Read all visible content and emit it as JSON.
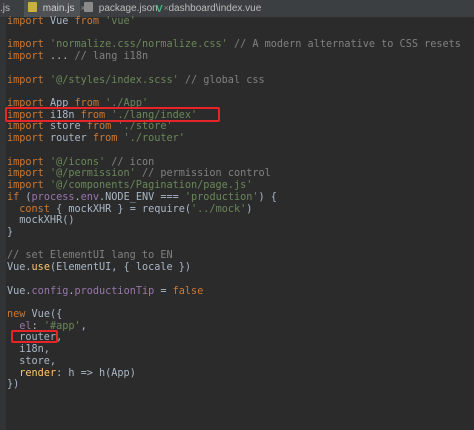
{
  "tabs": [
    {
      "label": ".js",
      "active": false,
      "icon": "js-file-icon"
    },
    {
      "label": "main.js",
      "active": true,
      "icon": "js-file-icon"
    },
    {
      "label": "package.json",
      "active": false,
      "icon": "json-file-icon"
    },
    {
      "label": "dashboard\\index.vue",
      "active": false,
      "icon": "vue-file-icon"
    }
  ],
  "close_glyph": "×",
  "lines": [
    [
      [
        "kw",
        "import "
      ],
      [
        "t",
        "Vue "
      ],
      [
        "kw",
        "from "
      ],
      [
        "str",
        "'vue'"
      ]
    ],
    [],
    [
      [
        "kw",
        "import "
      ],
      [
        "str",
        "'normalize.css/normalize.css' "
      ],
      [
        "cm",
        "// A modern alternative to CSS resets"
      ]
    ],
    [
      [
        "kw",
        "import "
      ],
      [
        "t",
        "... "
      ],
      [
        "cm",
        "// lang i18n"
      ]
    ],
    [],
    [
      [
        "kw",
        "import "
      ],
      [
        "str",
        "'@/styles/index.scss' "
      ],
      [
        "cm",
        "// global css"
      ]
    ],
    [],
    [
      [
        "kw",
        "import "
      ],
      [
        "t",
        "App "
      ],
      [
        "kw",
        "from "
      ],
      [
        "str",
        "'./App'"
      ]
    ],
    [
      [
        "kw",
        "import "
      ],
      [
        "t",
        "i18n "
      ],
      [
        "kw",
        "from "
      ],
      [
        "str",
        "'./lang/index'"
      ]
    ],
    [
      [
        "kw",
        "import "
      ],
      [
        "t",
        "store "
      ],
      [
        "kw",
        "from "
      ],
      [
        "str",
        "'./store'"
      ]
    ],
    [
      [
        "kw",
        "import "
      ],
      [
        "t",
        "router "
      ],
      [
        "kw",
        "from "
      ],
      [
        "str",
        "'./router'"
      ]
    ],
    [],
    [
      [
        "kw",
        "import "
      ],
      [
        "str",
        "'@/icons' "
      ],
      [
        "cm",
        "// icon"
      ]
    ],
    [
      [
        "kw",
        "import "
      ],
      [
        "str",
        "'@/permission' "
      ],
      [
        "cm",
        "// permission control"
      ]
    ],
    [
      [
        "kw",
        "import "
      ],
      [
        "str",
        "'@/components/Pagination/page.js'"
      ]
    ],
    [
      [
        "kw",
        "if "
      ],
      [
        "t",
        "("
      ],
      [
        "pr",
        "process"
      ],
      [
        "t",
        "."
      ],
      [
        "pr",
        "env"
      ],
      [
        "t",
        ".NODE_ENV === "
      ],
      [
        "str",
        "'production'"
      ],
      [
        "t",
        ") {"
      ]
    ],
    [
      [
        "t",
        "  "
      ],
      [
        "kw",
        "const "
      ],
      [
        "t",
        "{ mockXHR } = require("
      ],
      [
        "str",
        "'../mock'"
      ],
      [
        "t",
        ")"
      ]
    ],
    [
      [
        "t",
        "  mockXHR()"
      ]
    ],
    [
      [
        "t",
        "}"
      ]
    ],
    [],
    [
      [
        "cm",
        "// set ElementUI lang to EN"
      ]
    ],
    [
      [
        "t",
        "Vue."
      ],
      [
        "fn",
        "use"
      ],
      [
        "t",
        "(ElementUI, { locale })"
      ]
    ],
    [],
    [
      [
        "t",
        "Vue."
      ],
      [
        "pr",
        "config"
      ],
      [
        "t",
        "."
      ],
      [
        "pr",
        "productionTip "
      ],
      [
        "t",
        "= "
      ],
      [
        "kw",
        "false"
      ]
    ],
    [],
    [
      [
        "kw",
        "new "
      ],
      [
        "t",
        "Vue({"
      ]
    ],
    [
      [
        "t",
        "  "
      ],
      [
        "pr",
        "el"
      ],
      [
        "t",
        ": "
      ],
      [
        "str",
        "'#app'"
      ],
      [
        "t",
        ","
      ]
    ],
    [
      [
        "t",
        "  router,"
      ]
    ],
    [
      [
        "t",
        "  i18n,"
      ]
    ],
    [
      [
        "t",
        "  store,"
      ]
    ],
    [
      [
        "t",
        "  "
      ],
      [
        "fn",
        "render"
      ],
      [
        "t",
        ": h => h(App)"
      ]
    ],
    [
      [
        "t",
        "})"
      ]
    ]
  ]
}
